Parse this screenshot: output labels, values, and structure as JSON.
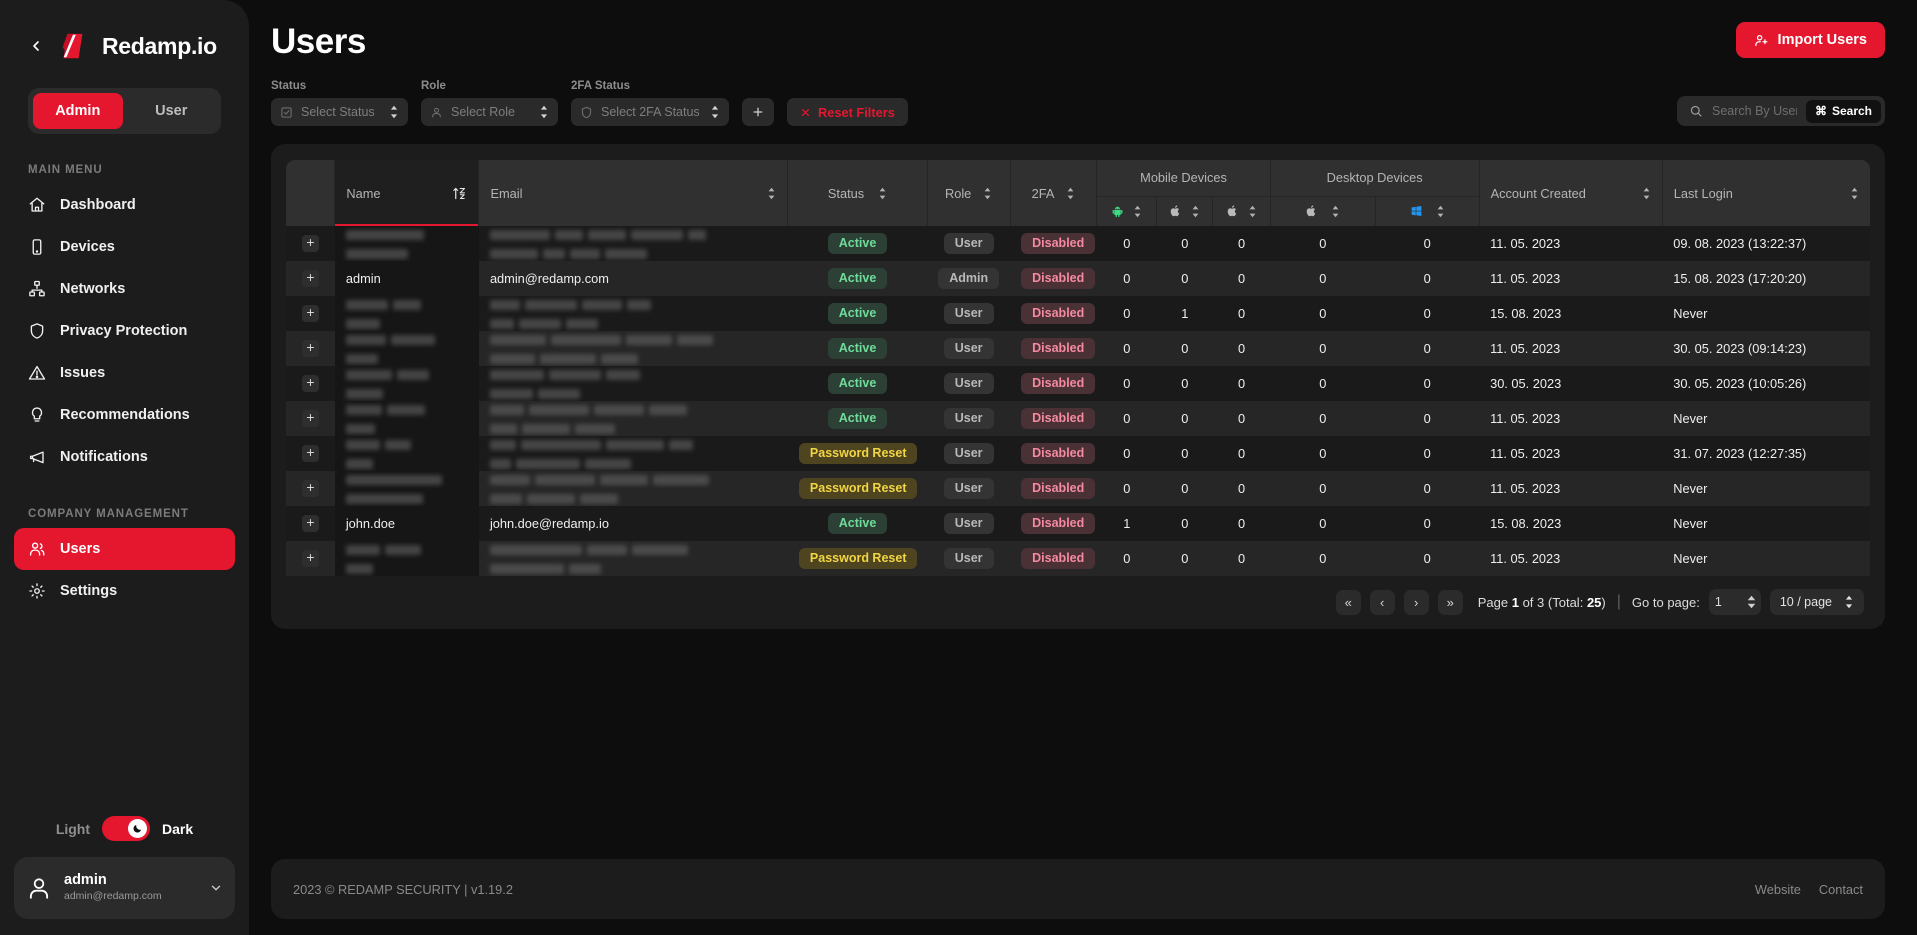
{
  "brand": {
    "name": "Redamp.io",
    "back_icon": "chevron-left-icon",
    "logo_icon": "redamp-logo-icon"
  },
  "role_toggle": {
    "admin": "Admin",
    "user": "User",
    "active": "Admin"
  },
  "sidebar": {
    "main_menu_label": "MAIN MENU",
    "company_label": "COMPANY MANAGEMENT",
    "main_items": [
      {
        "label": "Dashboard",
        "icon": "home-icon",
        "active": false
      },
      {
        "label": "Devices",
        "icon": "device-icon",
        "active": false
      },
      {
        "label": "Networks",
        "icon": "network-icon",
        "active": false
      },
      {
        "label": "Privacy Protection",
        "icon": "shield-icon",
        "active": false
      },
      {
        "label": "Issues",
        "icon": "warning-triangle-icon",
        "active": false
      },
      {
        "label": "Recommendations",
        "icon": "lightbulb-icon",
        "active": false
      },
      {
        "label": "Notifications",
        "icon": "megaphone-icon",
        "active": false
      }
    ],
    "company_items": [
      {
        "label": "Users",
        "icon": "users-icon",
        "active": true
      },
      {
        "label": "Settings",
        "icon": "gear-icon",
        "active": false
      }
    ],
    "theme": {
      "light": "Light",
      "dark": "Dark",
      "active": "Dark",
      "icon": "moon-icon"
    },
    "account": {
      "name": "admin",
      "email": "admin@redamp.com",
      "avatar_icon": "user-avatar-icon",
      "caret_icon": "chevron-down-icon"
    }
  },
  "header": {
    "title": "Users",
    "import_label": "Import Users",
    "import_icon": "user-plus-icon"
  },
  "filters": {
    "status": {
      "label": "Status",
      "placeholder": "Select Status",
      "icon": "check-square-icon"
    },
    "role": {
      "label": "Role",
      "placeholder": "Select Role",
      "icon": "user-icon"
    },
    "twofa": {
      "label": "2FA Status",
      "placeholder": "Select 2FA Status",
      "icon": "shield-icon"
    },
    "add_icon": "plus-icon",
    "reset_label": "Reset Filters",
    "reset_icon": "close-x-icon"
  },
  "search": {
    "placeholder": "Search By Username",
    "value": "",
    "button_label": "Search",
    "button_icon": "command-key-icon",
    "icon": "search-icon"
  },
  "table": {
    "group_headers": {
      "mobile": "Mobile Devices",
      "desktop": "Desktop Devices"
    },
    "columns": [
      {
        "key": "expand",
        "label": ""
      },
      {
        "key": "name",
        "label": "Name",
        "sorted": true,
        "sort_icon": "sort-za-icon"
      },
      {
        "key": "email",
        "label": "Email"
      },
      {
        "key": "status",
        "label": "Status"
      },
      {
        "key": "role",
        "label": "Role"
      },
      {
        "key": "twofa",
        "label": "2FA"
      },
      {
        "key": "created",
        "label": "Account Created"
      },
      {
        "key": "lastlogin",
        "label": "Last Login"
      }
    ],
    "device_columns": [
      {
        "key": "m_android",
        "icon": "android-icon",
        "color": "#3ddc84",
        "group": "mobile"
      },
      {
        "key": "m_ios",
        "icon": "apple-icon",
        "color": "#b9b9b9",
        "group": "mobile"
      },
      {
        "key": "m_ipad",
        "icon": "apple-icon",
        "color": "#b9b9b9",
        "group": "mobile"
      },
      {
        "key": "d_mac",
        "icon": "apple-icon",
        "color": "#b9b9b9",
        "group": "desktop"
      },
      {
        "key": "d_win",
        "icon": "windows-icon",
        "color": "#2196f3",
        "group": "desktop"
      }
    ],
    "rows": [
      {
        "name": "",
        "redacted": true,
        "name_w": [
          78
        ],
        "email": "",
        "email_w": [
          60,
          28,
          38,
          52,
          18
        ],
        "status": "Active",
        "role": "User",
        "twofa": "Disabled",
        "devices": [
          0,
          0,
          0,
          0,
          0
        ],
        "created": "11. 05. 2023",
        "lastlogin": "09. 08. 2023 (13:22:37)"
      },
      {
        "name": "admin",
        "redacted": false,
        "email": "admin@redamp.com",
        "status": "Active",
        "role": "Admin",
        "twofa": "Disabled",
        "devices": [
          0,
          0,
          0,
          0,
          0
        ],
        "created": "11. 05. 2023",
        "lastlogin": "15. 08. 2023 (17:20:20)"
      },
      {
        "name": "",
        "redacted": true,
        "name_w": [
          42,
          28
        ],
        "email": "",
        "email_w": [
          30,
          52,
          40,
          24
        ],
        "status": "Active",
        "role": "User",
        "twofa": "Disabled",
        "devices": [
          0,
          1,
          0,
          0,
          0
        ],
        "created": "15. 08. 2023",
        "lastlogin": "Never"
      },
      {
        "name": "",
        "redacted": true,
        "name_w": [
          40,
          44
        ],
        "email": "",
        "email_w": [
          56,
          70,
          46,
          36
        ],
        "status": "Active",
        "role": "User",
        "twofa": "Disabled",
        "devices": [
          0,
          0,
          0,
          0,
          0
        ],
        "created": "11. 05. 2023",
        "lastlogin": "30. 05. 2023 (09:14:23)"
      },
      {
        "name": "",
        "redacted": true,
        "name_w": [
          46,
          32
        ],
        "email": "",
        "email_w": [
          54,
          52,
          34
        ],
        "status": "Active",
        "role": "User",
        "twofa": "Disabled",
        "devices": [
          0,
          0,
          0,
          0,
          0
        ],
        "created": "30. 05. 2023",
        "lastlogin": "30. 05. 2023 (10:05:26)"
      },
      {
        "name": "",
        "redacted": true,
        "name_w": [
          36,
          38
        ],
        "email": "",
        "email_w": [
          34,
          60,
          50,
          38
        ],
        "status": "Active",
        "role": "User",
        "twofa": "Disabled",
        "devices": [
          0,
          0,
          0,
          0,
          0
        ],
        "created": "11. 05. 2023",
        "lastlogin": "Never"
      },
      {
        "name": "",
        "redacted": true,
        "name_w": [
          34,
          26
        ],
        "email": "",
        "email_w": [
          26,
          80,
          58,
          24
        ],
        "status": "Password Reset",
        "role": "User",
        "twofa": "Disabled",
        "devices": [
          0,
          0,
          0,
          0,
          0
        ],
        "created": "11. 05. 2023",
        "lastlogin": "31. 07. 2023 (12:27:35)"
      },
      {
        "name": "",
        "redacted": true,
        "name_w": [
          96
        ],
        "email": "",
        "email_w": [
          40,
          60,
          48,
          56
        ],
        "status": "Password Reset",
        "role": "User",
        "twofa": "Disabled",
        "devices": [
          0,
          0,
          0,
          0,
          0
        ],
        "created": "11. 05. 2023",
        "lastlogin": "Never"
      },
      {
        "name": "john.doe",
        "redacted": false,
        "email": "john.doe@redamp.io",
        "status": "Active",
        "role": "User",
        "twofa": "Disabled",
        "devices": [
          1,
          0,
          0,
          0,
          0
        ],
        "created": "15. 08. 2023",
        "lastlogin": "Never"
      },
      {
        "name": "",
        "redacted": true,
        "name_w": [
          34,
          36
        ],
        "email": "",
        "email_w": [
          92,
          40,
          56
        ],
        "status": "Password Reset",
        "role": "User",
        "twofa": "Disabled",
        "devices": [
          0,
          0,
          0,
          0,
          0
        ],
        "created": "11. 05. 2023",
        "lastlogin": "Never"
      }
    ]
  },
  "pager": {
    "first_icon": "chevrons-left-icon",
    "prev_icon": "chevron-left-icon",
    "next_icon": "chevron-right-icon",
    "last_icon": "chevrons-right-icon",
    "page_prefix": "Page",
    "current_page": "1",
    "of_label": "of",
    "total_pages": "3",
    "total_text": "(Total:",
    "total_count": "25",
    "total_suffix": ")",
    "goto_label": "Go to page:",
    "goto_value": "1",
    "page_size": "10 / page"
  },
  "footer": {
    "copyright": "2023 © REDAMP SECURITY | v1.19.2",
    "website": "Website",
    "contact": "Contact"
  },
  "colors": {
    "accent": "#e4172f",
    "android_green": "#3ddc84",
    "windows_blue": "#2196f3",
    "active_green": "#6fdc9a",
    "warn_yellow": "#f2d544",
    "danger_pink": "#f58aa0"
  }
}
